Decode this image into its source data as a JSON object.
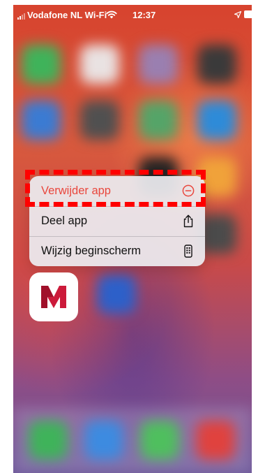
{
  "status_bar": {
    "carrier": "Vodafone NL Wi-Fi",
    "time": "12:37"
  },
  "context_menu": {
    "items": [
      {
        "label": "Verwijder app",
        "icon": "remove-circle-icon",
        "destructive": true
      },
      {
        "label": "Deel app",
        "icon": "share-icon",
        "destructive": false
      },
      {
        "label": "Wijzig beginscherm",
        "icon": "phone-edit-icon",
        "destructive": false
      }
    ]
  },
  "app": {
    "icon": "app-logo-m-icon",
    "brand_color": "#cc1a3a"
  },
  "colors": {
    "destructive": "#e9473d",
    "highlight": "#ff0000"
  }
}
